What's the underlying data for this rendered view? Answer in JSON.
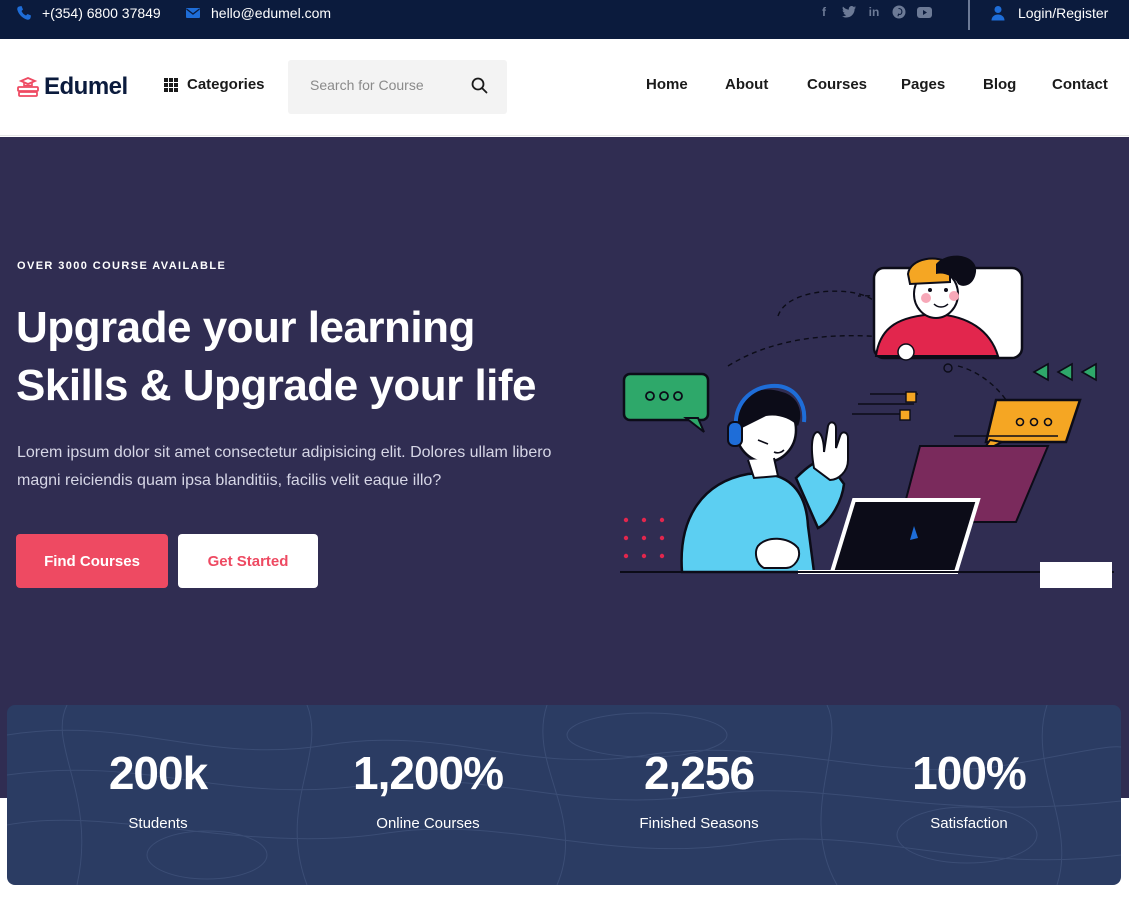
{
  "topbar": {
    "phone": "+(354) 6800 37849",
    "email": "hello@edumel.com",
    "socials": [
      "facebook-icon",
      "twitter-icon",
      "linkedin-icon",
      "pinterest-icon",
      "youtube-icon"
    ],
    "login": "Login/Register"
  },
  "header": {
    "logo": "Edumel",
    "categories": "Categories",
    "search_placeholder": "Search for Course",
    "nav": [
      "Home",
      "About",
      "Courses",
      "Pages",
      "Blog",
      "Contact"
    ]
  },
  "hero": {
    "eyebrow": "OVER 3000 COURSE AVAILABLE",
    "headline": [
      "Upgrade your learning",
      "Skills & Upgrade your life"
    ],
    "lede": "Lorem ipsum dolor sit amet consectetur adipisicing elit. Dolores ullam libero magni reiciendis quam ipsa blanditiis, facilis velit eaque illo?",
    "primary_button": "Find Courses",
    "secondary_button": "Get Started"
  },
  "stats": [
    {
      "value": "200k",
      "label": "Students"
    },
    {
      "value": "1,200%",
      "label": "Online Courses"
    },
    {
      "value": "2,256",
      "label": "Finished Seasons"
    },
    {
      "value": "100%",
      "label": "Satisfaction"
    }
  ],
  "colors": {
    "topbar": "#0b1b3d",
    "hero": "#302d52",
    "accent": "#ee4a62",
    "icon_blue": "#1e6dd8",
    "stats": "#2b3c63"
  }
}
